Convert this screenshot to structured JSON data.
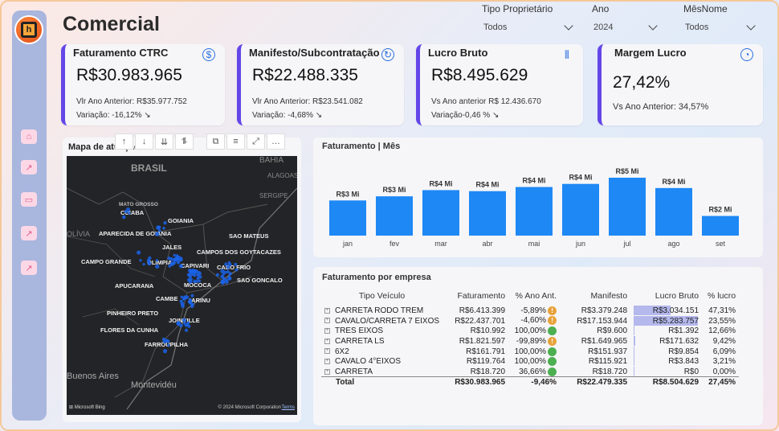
{
  "page_title": "Comercial",
  "filters": [
    {
      "label": "Tipo Proprietário",
      "value": "Todos"
    },
    {
      "label": "Ano",
      "value": "2024"
    },
    {
      "label": "MêsNome",
      "value": "Todos"
    }
  ],
  "kpis": [
    {
      "title": "Faturamento CTRC",
      "value": "R$30.983.965",
      "line1": "Vlr Ano Anterior: R$35.977.752",
      "line2": "Variação: -16,12% ↘",
      "icon": "dollar-icon"
    },
    {
      "title": "Manifesto/Subcontratação",
      "value": "R$22.488.335",
      "line1": "Vlr Ano Anterior: R$23.541.082",
      "line2": "Variação: -4,68% ↘",
      "icon": "refresh-icon"
    },
    {
      "title": "Lucro Bruto",
      "value": "R$8.495.629",
      "line1": "Vs Ano anterior R$ 12.436.670",
      "line2": "Variação-0,46 % ↘",
      "icon": "candlestick-icon"
    },
    {
      "title": "Margem Lucro",
      "value": "27,42%",
      "line1": "Vs Ano Anterior: 34,57%",
      "line2": "",
      "icon": "pie-icon"
    }
  ],
  "map": {
    "title": "Mapa de atuação",
    "footer_brand": "Microsoft Bing",
    "copyright": "© 2024 Microsoft Corporation",
    "terms": "Terms",
    "regions": [
      "BRASIL",
      "BAHIA",
      "ALAGOAS",
      "SERGIPE",
      "OLÍVIA",
      "Buenos Aires",
      "Montevidéu"
    ],
    "cities": [
      "MATO GROSSO",
      "CUIABA",
      "GOIANIA",
      "APARECIDA DE GOIANIA",
      "SAO MATEUS",
      "JALES",
      "CAMPOS DOS GOYTACAZES",
      "CAMPO GRANDE",
      "OLIMPIA",
      "CAPIVARI",
      "CABO FRIO",
      "SAO GONCALO",
      "APUCARANA",
      "MOCOCA",
      "CAMBE",
      "JARINU",
      "PINHEIRO PRETO",
      "JOINVILLE",
      "FLORES DA CUNHA",
      "FARROUPILHA"
    ]
  },
  "toolbar": [
    "↑",
    "↓",
    "⇊",
    "⥮",
    "⧉",
    "≡",
    "⤢",
    "…"
  ],
  "chart_data": {
    "type": "bar",
    "title": "Faturamento | Mês",
    "categories": [
      "jan",
      "fev",
      "mar",
      "abr",
      "mai",
      "jun",
      "jul",
      "ago",
      "set"
    ],
    "values": [
      3.4,
      3.8,
      4.4,
      4.3,
      4.7,
      5.0,
      5.6,
      4.6,
      1.9
    ],
    "data_labels": [
      "R$3 Mi",
      "R$3 Mi",
      "R$4 Mi",
      "R$4 Mi",
      "R$4 Mi",
      "R$4 Mi",
      "R$5 Mi",
      "R$4 Mi",
      "R$2 Mi"
    ],
    "ylim": [
      0,
      5.6
    ],
    "bar_color": "#1e88f5",
    "grid": false
  },
  "table": {
    "title": "Faturamento por empresa",
    "headers": [
      "Tipo Veículo",
      "Faturamento",
      "% Ano Ant.",
      "Manifesto",
      "Lucro Bruto",
      "% lucro"
    ],
    "rows": [
      {
        "tipo": "CARRETA RODO TREM",
        "fat": "R$6.413.399",
        "pct": "-5,89%",
        "status": "warning",
        "man": "R$3.379.248",
        "lucro": "R$3.034.151",
        "lucro_fill": 0.57,
        "plucro": "47,31%"
      },
      {
        "tipo": "CAVALO/CARRETA 7 EIXOS",
        "fat": "R$22.437.701",
        "pct": "-4,60%",
        "status": "warning",
        "man": "R$17.153.944",
        "lucro": "R$5.283.757",
        "lucro_fill": 1.0,
        "plucro": "23,55%"
      },
      {
        "tipo": "TRES EIXOS",
        "fat": "R$10.992",
        "pct": "100,00%",
        "status": "ok",
        "man": "R$9.600",
        "lucro": "R$1.392",
        "lucro_fill": 0.0,
        "plucro": "12,66%"
      },
      {
        "tipo": "CARRETA LS",
        "fat": "R$1.821.597",
        "pct": "-99,89%",
        "status": "warning",
        "man": "R$1.649.965",
        "lucro": "R$171.632",
        "lucro_fill": 0.03,
        "plucro": "9,42%"
      },
      {
        "tipo": "6X2",
        "fat": "R$161.791",
        "pct": "100,00%",
        "status": "ok",
        "man": "R$151.937",
        "lucro": "R$9.854",
        "lucro_fill": 0.0,
        "plucro": "6,09%"
      },
      {
        "tipo": "CAVALO 4°EIXOS",
        "fat": "R$119.764",
        "pct": "100,00%",
        "status": "ok",
        "man": "R$115.921",
        "lucro": "R$3.843",
        "lucro_fill": 0.0,
        "plucro": "3,21%"
      },
      {
        "tipo": "CARRETA",
        "fat": "R$18.720",
        "pct": "36,66%",
        "status": "ok",
        "man": "R$18.720",
        "lucro": "R$0",
        "lucro_fill": 0.0,
        "plucro": "0,00%"
      }
    ],
    "total": {
      "tipo": "Total",
      "fat": "R$30.983.965",
      "pct": "-9,46%",
      "man": "R$22.479.335",
      "lucro": "R$8.504.629",
      "plucro": "27,45%"
    }
  },
  "colors": {
    "accent": "#6446e8",
    "bar": "#1e88f5",
    "warning": "#e8a23a",
    "ok": "#4caf50",
    "databar": "#b4b8ec"
  }
}
